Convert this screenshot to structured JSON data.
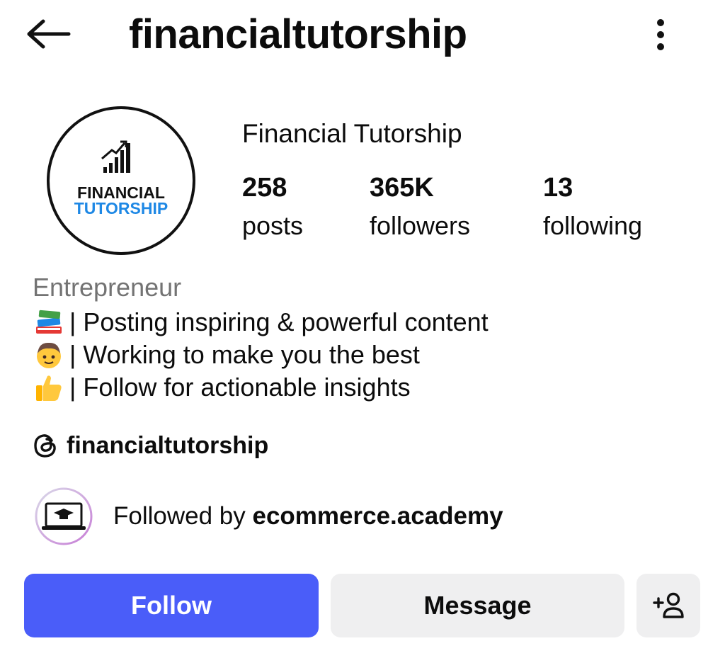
{
  "header": {
    "username": "financialtutorship",
    "back_icon": "arrow-left-icon",
    "more_icon": "more-vertical-icon"
  },
  "profile": {
    "avatar_text_line1": "FINANCIAL",
    "avatar_text_line2": "TUTORSHIP",
    "display_name": "Financial Tutorship"
  },
  "stats": [
    {
      "value": "258",
      "label": "posts"
    },
    {
      "value": "365K",
      "label": "followers"
    },
    {
      "value": "13",
      "label": "following"
    }
  ],
  "bio": {
    "category": "Entrepreneur",
    "lines": [
      {
        "emoji": "books-emoji",
        "text": "| Posting inspiring & powerful content"
      },
      {
        "emoji": "boy-emoji",
        "text": "| Working to make you the best"
      },
      {
        "emoji": "thumbs-up-emoji",
        "text": "| Follow for actionable insights"
      }
    ]
  },
  "threads": {
    "icon": "threads-icon",
    "handle": "financialtutorship"
  },
  "followed_by": {
    "prefix": "Followed by ",
    "account": "ecommerce.academy"
  },
  "actions": {
    "follow_label": "Follow",
    "message_label": "Message",
    "suggest_icon": "add-person-icon"
  },
  "colors": {
    "accent": "#4a5df9",
    "secondary_button": "#efeff0",
    "muted_text": "#737373",
    "logo_blue": "#1e88e5"
  }
}
